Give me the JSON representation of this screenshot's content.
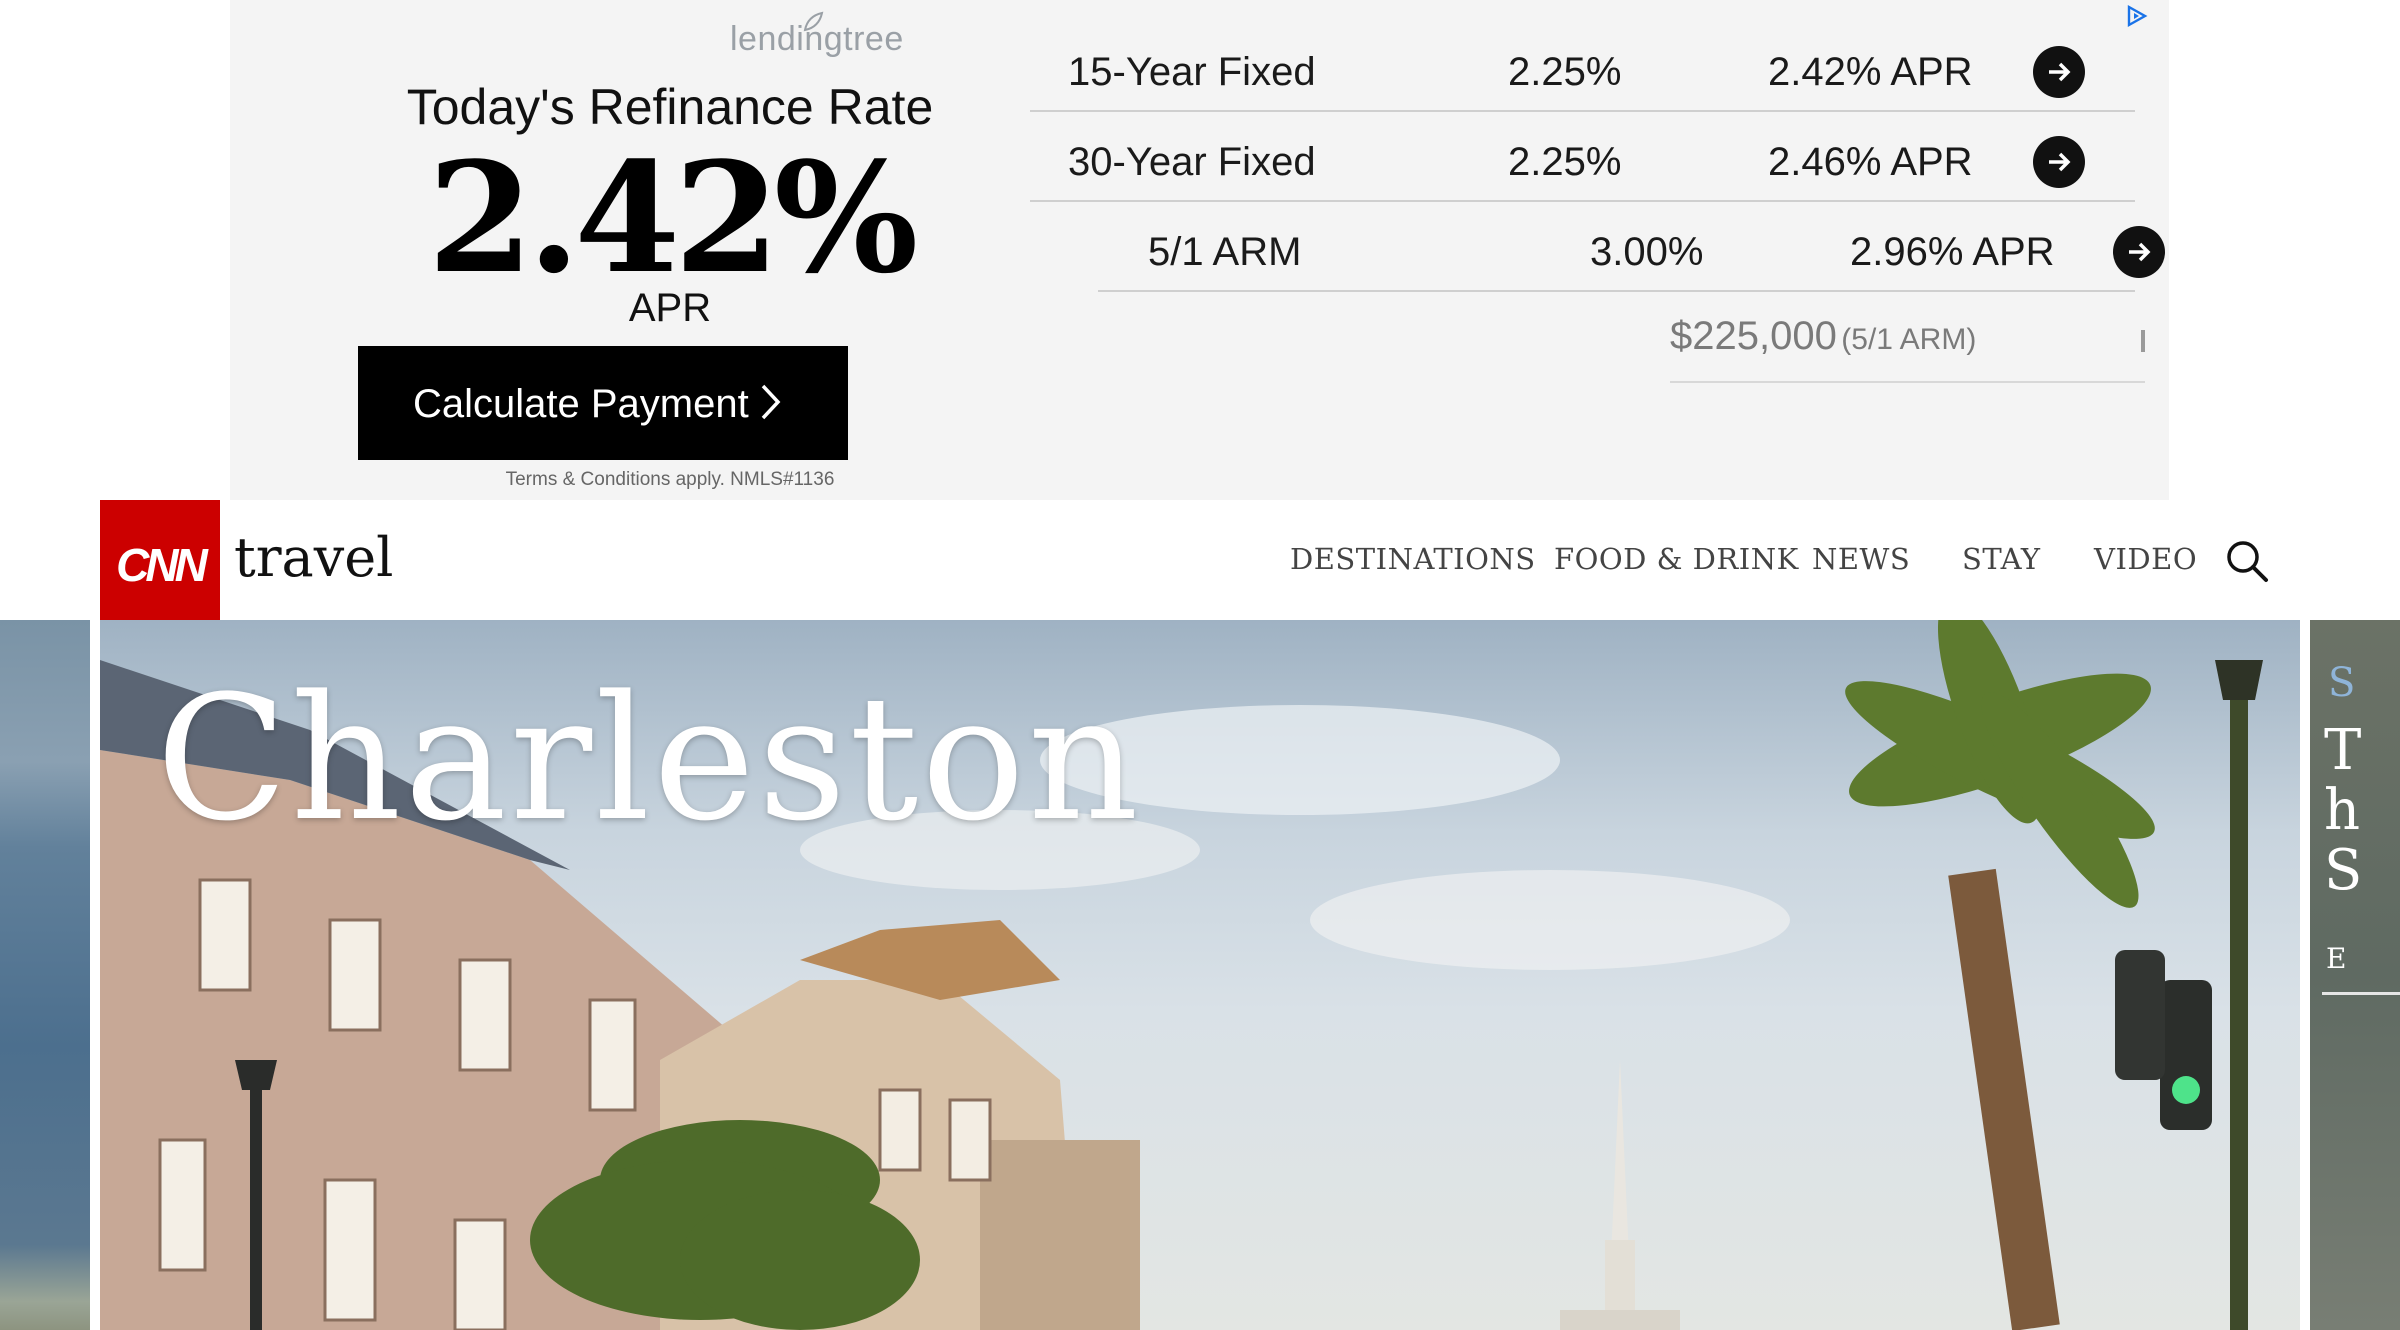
{
  "ad": {
    "brand": "lendingtree",
    "heading": "Today's Refinance Rate",
    "big_rate": "2.42%",
    "big_rate_unit": "APR",
    "cta_label": "Calculate Payment",
    "terms": "Terms & Conditions apply. NMLS#1136",
    "rows": [
      {
        "product": "15-Year Fixed",
        "rate": "2.25%",
        "apr": "2.42% APR"
      },
      {
        "product": "30-Year Fixed",
        "rate": "2.25%",
        "apr": "2.46% APR"
      },
      {
        "product": "5/1 ARM",
        "rate": "3.00%",
        "apr": "2.96% APR"
      }
    ],
    "loan_amount": "$225,000",
    "loan_type": "(5/1 ARM)",
    "icons": {
      "choices": "ad-choices-icon",
      "arrow": "arrow-right-circle-icon",
      "leaf": "leaf-icon"
    }
  },
  "header": {
    "logo": "CNN",
    "section": "travel",
    "nav": [
      "DESTINATIONS",
      "FOOD & DRINK",
      "NEWS",
      "STAY",
      "VIDEO"
    ],
    "search_icon": "search-icon"
  },
  "hero": {
    "title": "Charleston",
    "next_card_letters": [
      "S",
      "T",
      "h",
      "S",
      "E"
    ]
  },
  "colors": {
    "cnn_red": "#cc0000",
    "ad_background": "#f4f4f4",
    "cta_background": "#000000",
    "nav_text": "#444444"
  }
}
